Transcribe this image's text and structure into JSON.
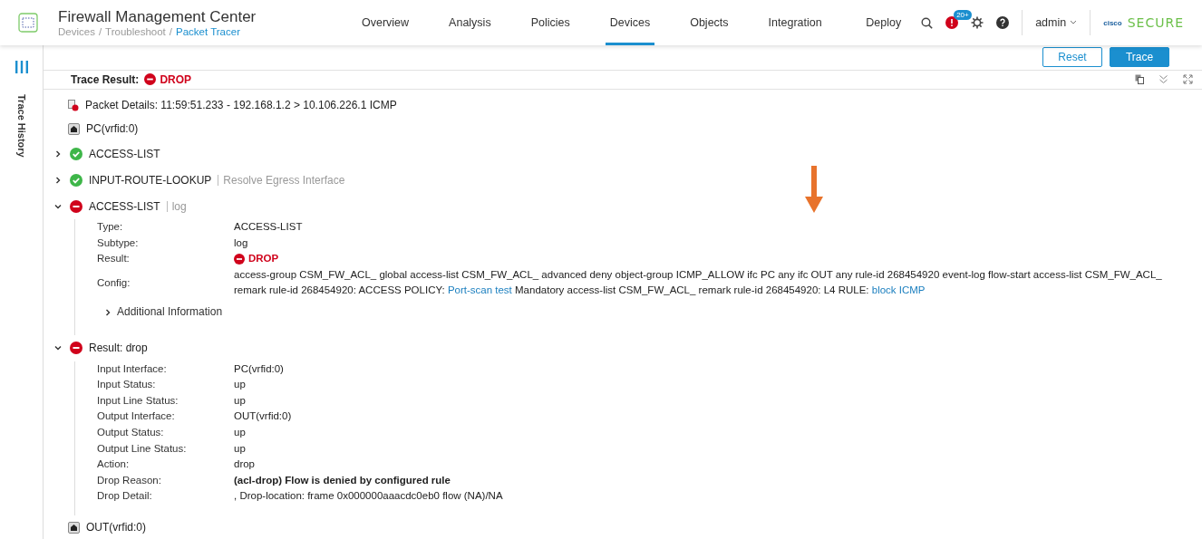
{
  "header": {
    "title": "Firewall Management Center",
    "breadcrumb": [
      {
        "label": "Devices",
        "current": false
      },
      {
        "label": "Troubleshoot",
        "current": false
      },
      {
        "label": "Packet Tracer",
        "current": true
      }
    ],
    "separator": "/",
    "nav": [
      {
        "label": "Overview",
        "selected": false
      },
      {
        "label": "Analysis",
        "selected": false
      },
      {
        "label": "Policies",
        "selected": false
      },
      {
        "label": "Devices",
        "selected": true
      },
      {
        "label": "Objects",
        "selected": false
      },
      {
        "label": "Integration",
        "selected": false
      }
    ],
    "deploy": "Deploy",
    "alerts_badge": "20+",
    "user": "admin",
    "brand_mark": "cisco",
    "brand": "SECURE"
  },
  "sidebar": {
    "label": "Trace History"
  },
  "toolbar": [
    {
      "label": "Reset",
      "kind": "secondary"
    },
    {
      "label": "Trace",
      "kind": "primary"
    }
  ],
  "trace_result": {
    "label": "Trace Result:",
    "result": "DROP"
  },
  "packet_details": "Packet Details: 11:59:51.233 - 192.168.1.2 > 10.106.226.1 ICMP",
  "steps": [
    {
      "kind": "node",
      "title": "PC(vrfid:0)"
    },
    {
      "kind": "phase",
      "dropped": false,
      "expanded": false,
      "title": "ACCESS-LIST"
    },
    {
      "kind": "phase",
      "dropped": false,
      "expanded": false,
      "title": "INPUT-ROUTE-LOOKUP",
      "subtitle": "Resolve Egress Interface"
    },
    {
      "kind": "phase",
      "dropped": true,
      "expanded": true,
      "title": "ACCESS-LIST",
      "subtitle": "log",
      "details": [
        {
          "label": "Type:",
          "kind": "text",
          "value": "ACCESS-LIST"
        },
        {
          "label": "Subtype:",
          "kind": "text",
          "value": "log"
        },
        {
          "label": "Result:",
          "kind": "drop",
          "value": "DROP"
        },
        {
          "label": "Config:",
          "kind": "config",
          "parts": [
            {
              "kind": "text",
              "text": "access-group CSM_FW_ACL_ global access-list CSM_FW_ACL_ advanced deny object-group ICMP_ALLOW ifc PC any ifc OUT any rule-id 268454920 event-log flow-start access-list CSM_FW_ACL_ remark rule-id 268454920: ACCESS POLICY: "
            },
            {
              "kind": "link",
              "text": "Port-scan test"
            },
            {
              "kind": "text",
              "text": " Mandatory access-list CSM_FW_ACL_ remark rule-id 268454920: L4 RULE: "
            },
            {
              "kind": "link",
              "text": "block ICMP"
            }
          ]
        }
      ],
      "more": {
        "label": "Additional Information",
        "expanded": false
      }
    },
    {
      "kind": "phase",
      "dropped": true,
      "expanded": true,
      "title": "Result: drop",
      "details": [
        {
          "label": "Input Interface:",
          "kind": "text",
          "value": "PC(vrfid:0)"
        },
        {
          "label": "Input Status:",
          "kind": "text",
          "value": "up"
        },
        {
          "label": "Input Line Status:",
          "kind": "text",
          "value": "up"
        },
        {
          "label": "Output Interface:",
          "kind": "text",
          "value": "OUT(vrfid:0)"
        },
        {
          "label": "Output Status:",
          "kind": "text",
          "value": "up"
        },
        {
          "label": "Output Line Status:",
          "kind": "text",
          "value": "up"
        },
        {
          "label": "Action:",
          "kind": "text",
          "value": "drop"
        },
        {
          "label": "Drop Reason:",
          "kind": "bold",
          "value": "(acl-drop) Flow is denied by configured rule"
        },
        {
          "label": "Drop Detail:",
          "kind": "text",
          "value": ", Drop-location: frame 0x000000aaacdc0eb0 flow (NA)/NA"
        }
      ]
    },
    {
      "kind": "node",
      "title": "OUT(vrfid:0)"
    }
  ]
}
